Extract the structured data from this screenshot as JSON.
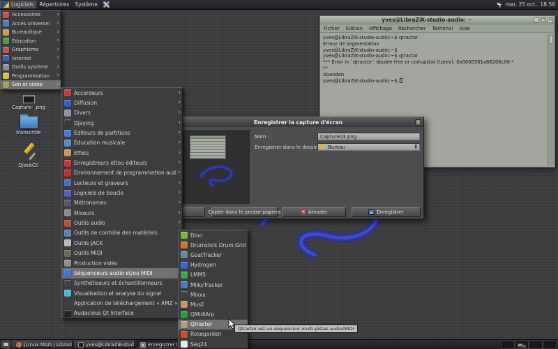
{
  "colors": {
    "selection": "#717171",
    "terminal_titlebar": "#a9b3a3",
    "dialog_bg": "#4e4e50",
    "folder_blue": "#4a86c8",
    "swirl_blue": "#2a3ad0",
    "panel_bg": "#26262a"
  },
  "panel": {
    "menus": [
      "Logiciels",
      "Répertoires",
      "Système"
    ],
    "clock": "mar. 25 oct.. 18:56"
  },
  "menu1": {
    "items": [
      {
        "label": "Accessoires",
        "icon": "accessories-icon",
        "color": "#c05050",
        "submenu": true
      },
      {
        "label": "Accès universel",
        "icon": "accessibility-icon",
        "color": "#4a7ac8",
        "submenu": true
      },
      {
        "label": "Bureautique",
        "icon": "office-icon",
        "color": "#c8a048",
        "submenu": true
      },
      {
        "label": "Éducation",
        "icon": "education-icon",
        "color": "#50a050",
        "submenu": true
      },
      {
        "label": "Graphisme",
        "icon": "graphics-icon",
        "color": "#c05858",
        "submenu": true
      },
      {
        "label": "Internet",
        "icon": "internet-icon",
        "color": "#4060c0",
        "submenu": true
      },
      {
        "label": "Outils système",
        "icon": "system-tools-icon",
        "color": "#8890a0",
        "submenu": true
      },
      {
        "label": "Programmation",
        "icon": "programming-icon",
        "color": "#d8c050",
        "submenu": true
      },
      {
        "label": "Son et vidéo",
        "icon": "sound-video-icon",
        "color": "#a8a058",
        "submenu": true,
        "selected": true
      }
    ]
  },
  "menu2": {
    "items": [
      {
        "label": "Accordeurs",
        "icon": "tuner-icon",
        "color": "#c04040",
        "submenu": true
      },
      {
        "label": "Diffusion",
        "icon": "broadcast-icon",
        "color": "#3858c8",
        "submenu": true
      },
      {
        "label": "Divers",
        "icon": "misc-icon",
        "color": "#9090a0",
        "submenu": true
      },
      {
        "label": "Djaying",
        "icon": "dj-icon",
        "color": "#383838",
        "submenu": true
      },
      {
        "label": "Éditeurs de partitions",
        "icon": "score-editor-icon",
        "color": "#4878d0",
        "submenu": true
      },
      {
        "label": "Éducation musicale",
        "icon": "music-education-icon",
        "color": "#5888c0",
        "submenu": true
      },
      {
        "label": "Effets",
        "icon": "effects-icon",
        "color": "#c09858",
        "submenu": true
      },
      {
        "label": "Enregistreurs et/ou éditeurs",
        "icon": "recorder-icon",
        "color": "#c03838",
        "submenu": true
      },
      {
        "label": "Environnement de programmation audio",
        "icon": "audio-programming-icon",
        "color": "#b83030",
        "submenu": true
      },
      {
        "label": "Lecteurs et graveurs",
        "icon": "player-burner-icon",
        "color": "#4870b8",
        "submenu": true
      },
      {
        "label": "Logiciels de boucle",
        "icon": "loop-software-icon",
        "color": "#5060b0",
        "submenu": true
      },
      {
        "label": "Métronomes",
        "icon": "metronome-icon",
        "color": "#555566",
        "submenu": true
      },
      {
        "label": "Mixeurs",
        "icon": "mixer-icon",
        "color": "#888888",
        "submenu": true
      },
      {
        "label": "Outils audio",
        "icon": "audio-tools-icon",
        "color": "#b05040",
        "submenu": true
      },
      {
        "label": "Outils de contrôle des matériels",
        "icon": "hardware-control-icon",
        "color": "#6080b0",
        "submenu": true
      },
      {
        "label": "Outils JACK",
        "icon": "jack-tools-icon",
        "color": "#b8b8b8",
        "submenu": true
      },
      {
        "label": "Outils MIDI",
        "icon": "midi-tools-icon",
        "color": "#706858",
        "submenu": true
      },
      {
        "label": "Production vidéo",
        "icon": "video-production-icon",
        "color": "#909090",
        "submenu": true
      },
      {
        "label": "Séquenceurs audio et/ou MIDI",
        "icon": "sequencer-icon",
        "color": "#3878d8",
        "submenu": true,
        "selected": true
      },
      {
        "label": "Synthétiseurs et échantillonneurs",
        "icon": "synth-icon",
        "color": "#404048",
        "submenu": true
      },
      {
        "label": "Visualisation et analyse du signal",
        "icon": "signal-analysis-icon",
        "color": "#58b0d8",
        "submenu": true
      },
      {
        "label": "Application de téléchargement « AMZ »",
        "icon": null,
        "submenu": false
      },
      {
        "label": "Audacious Qt Interface",
        "icon": "audacious-icon",
        "color": "#222222",
        "submenu": false
      }
    ]
  },
  "menu3": {
    "items": [
      {
        "label": "Dino",
        "icon": "dino-icon",
        "color": "#78b838"
      },
      {
        "label": "Drumstick Drum Grid",
        "icon": "drumstick-icon",
        "color": "#d07828"
      },
      {
        "label": "GoatTracker",
        "icon": "goattracker-icon",
        "color": "#6888a8"
      },
      {
        "label": "Hydrogen",
        "icon": "hydrogen-icon",
        "color": "#3868c8"
      },
      {
        "label": "LMMS",
        "icon": "lmms-icon",
        "color": "#38a848"
      },
      {
        "label": "MilkyTracker",
        "icon": "milkytracker-icon",
        "color": "#4878c8"
      },
      {
        "label": "Mixxx",
        "icon": "mixxx-icon",
        "color": "#404040"
      },
      {
        "label": "MusE",
        "icon": "muse-icon",
        "color": "#c09858"
      },
      {
        "label": "QMidiArp",
        "icon": "qmidiarp-icon",
        "color": "#28a038"
      },
      {
        "label": "Qtractor",
        "icon": "qtractor-icon",
        "color": "#b0a070",
        "selected": true
      },
      {
        "label": "Rosegarden",
        "icon": "rosegarden-icon",
        "color": "#d04828"
      },
      {
        "label": "Seq24",
        "icon": "seq24-icon",
        "color": "#e8e8e8"
      }
    ]
  },
  "tooltip": {
    "text": "Qtractor est un séquenceur multi-pistes audio/MIDI"
  },
  "terminal": {
    "title": "yves@LibraZiK-studio-audio: ~",
    "menu": [
      "Fichier",
      "Édition",
      "Affichage",
      "Rechercher",
      "Terminal",
      "Aide"
    ],
    "lines": [
      "yves@LibraZiK-studio-audio:~$ qtractor",
      "Erreur de segmentation",
      "yves@LibraZiK-studio-audio:~$",
      "yves@LibraZiK-studio-audio:~$ qtractor",
      "*** Error in `qtractor': double free or corruption (!prev): 0x0000561a88206c00 *",
      "**",
      "Abandon",
      "yves@LibraZiK-studio-audio:~$ "
    ]
  },
  "dialog": {
    "title": "Enregistrer la capture d'écran",
    "name_label": "Nom :",
    "name_value": "Capture03.png",
    "folder_label": "Enregistrer dans le dossier :",
    "folder_value": "Bureau",
    "buttons": [
      "Copier dans le presse-papiers",
      "Annuler",
      "Enregistrer"
    ]
  },
  "desktop_icons": [
    {
      "label": "Capture- .png"
    },
    {
      "label": "transcribe"
    },
    {
      "label": "QjackCtl"
    }
  ],
  "taskbar": {
    "tasks": [
      {
        "label": "[Linux MAO | Librazik ...",
        "icon": "firefox-icon",
        "cls": "firefox"
      },
      {
        "label": "yves@LibraZiK-studi...",
        "icon": "terminal-icon",
        "cls": "terminal"
      },
      {
        "label": "Enregistrer la c",
        "icon": "screenshot-icon",
        "cls": "screenshot",
        "active": true
      }
    ]
  }
}
